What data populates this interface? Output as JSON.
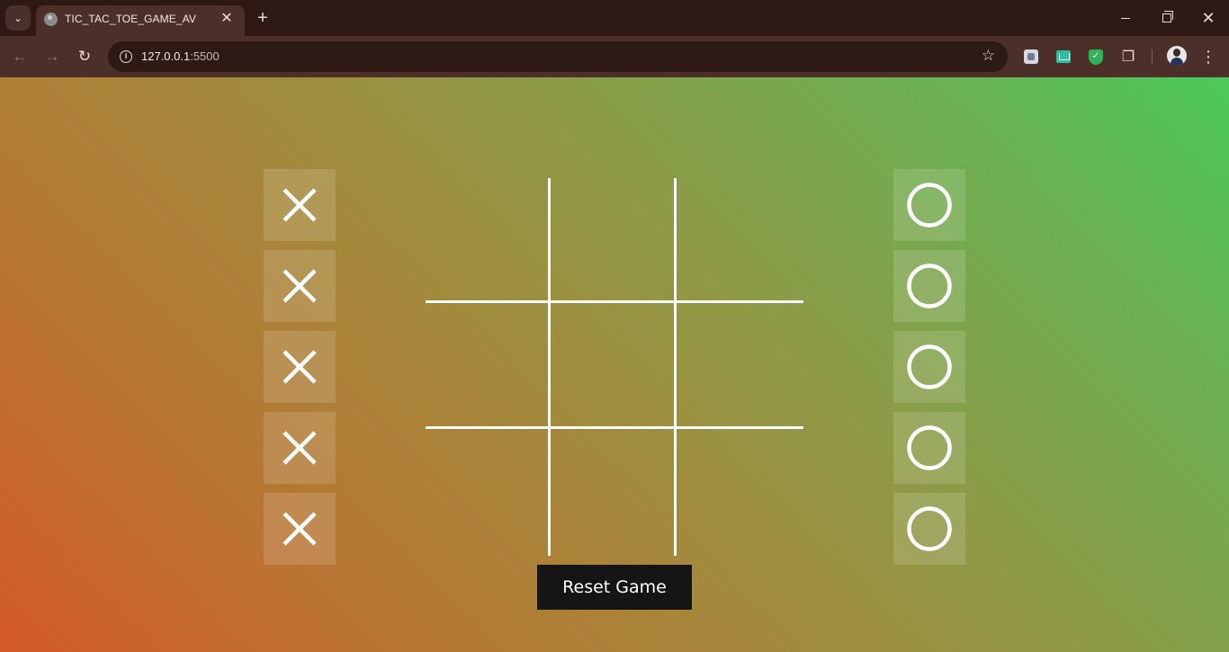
{
  "browser": {
    "tab_title": "TIC_TAC_TOE_GAME_AV",
    "tab_close": "✕",
    "new_tab": "+",
    "url_host": "127.0.0.1",
    "url_port": ":5500"
  },
  "game": {
    "x_pieces": [
      "x",
      "x",
      "x",
      "x",
      "x"
    ],
    "o_pieces": [
      "o",
      "o",
      "o",
      "o",
      "o"
    ],
    "board": [
      "",
      "",
      "",
      "",
      "",
      "",
      "",
      "",
      ""
    ],
    "reset_label": "Reset Game"
  },
  "icons": {
    "x_piece": "x-mark-icon",
    "o_piece": "o-ring-icon"
  },
  "colors": {
    "gradient_start": "#4bc95a",
    "gradient_end": "#d45a2a",
    "board_lines": "#ffffff",
    "button_bg": "#151515"
  }
}
